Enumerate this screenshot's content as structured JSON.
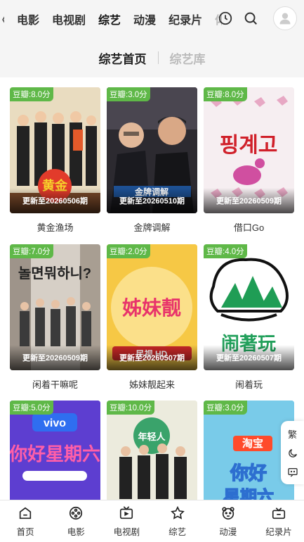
{
  "top_categories": [
    "电影",
    "电视剧",
    "综艺",
    "动漫",
    "纪录片"
  ],
  "active_category": "综艺",
  "subtabs": [
    "综艺首页",
    "综艺库"
  ],
  "cards": [
    {
      "title": "黄金渔场",
      "score": "豆瓣:8.0分",
      "update": "更新至20260506期",
      "bg": "#d8c9a8"
    },
    {
      "title": "金牌调解",
      "score": "豆瓣:3.0分",
      "update": "更新至20260510期",
      "bg": "#3d3a3a"
    },
    {
      "title": "借口Go",
      "score": "豆瓣:8.0分",
      "update": "更新至20260509期",
      "bg": "#f3eaee"
    },
    {
      "title": "闲着干嘛呢",
      "score": "豆瓣:7.0分",
      "update": "更新至20260509期",
      "bg": "#c9c0b8"
    },
    {
      "title": "姊妹靓起来",
      "score": "豆瓣:2.0分",
      "update": "更新至20260507期",
      "bg": "#f6c440"
    },
    {
      "title": "闹着玩",
      "score": "豆瓣:4.0分",
      "update": "更新至20260507期",
      "bg": "#ffffff"
    },
    {
      "title": "",
      "score": "豆瓣:5.0分",
      "update": "",
      "bg": "#5a3bc6"
    },
    {
      "title": "",
      "score": "豆瓣:10.0分",
      "update": "",
      "bg": "#e8e4d4"
    },
    {
      "title": "",
      "score": "豆瓣:3.0分",
      "update": "",
      "bg": "#6cc3e8"
    }
  ],
  "side_widget": {
    "label": "繁"
  },
  "bottom_nav": [
    "首页",
    "电影",
    "电视剧",
    "综艺",
    "动漫",
    "纪录片"
  ],
  "colors": {
    "accent_red": "#e02020",
    "score_green": "#5fb848",
    "active_underline": "#f7c948"
  }
}
